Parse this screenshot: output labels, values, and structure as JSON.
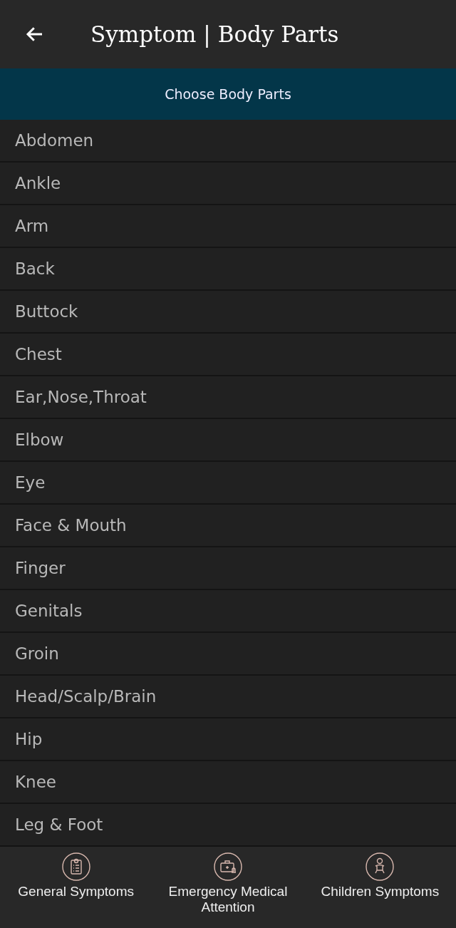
{
  "header": {
    "title": "Symptom | Body Parts"
  },
  "banner": {
    "label": "Choose Body Parts"
  },
  "body_parts": [
    "Abdomen",
    "Ankle",
    "Arm",
    "Back",
    "Buttock",
    "Chest",
    "Ear,Nose,Throat",
    "Elbow",
    "Eye",
    "Face & Mouth",
    "Finger",
    "Genitals",
    "Groin",
    "Head/Scalp/Brain",
    "Hip",
    "Knee",
    "Leg & Foot"
  ],
  "bottom_nav": [
    {
      "kind": "clipboard",
      "label": "General Symptoms"
    },
    {
      "kind": "firstaid",
      "label": "Emergency Medical Attention"
    },
    {
      "kind": "baby",
      "label": "Children Symptoms"
    }
  ]
}
